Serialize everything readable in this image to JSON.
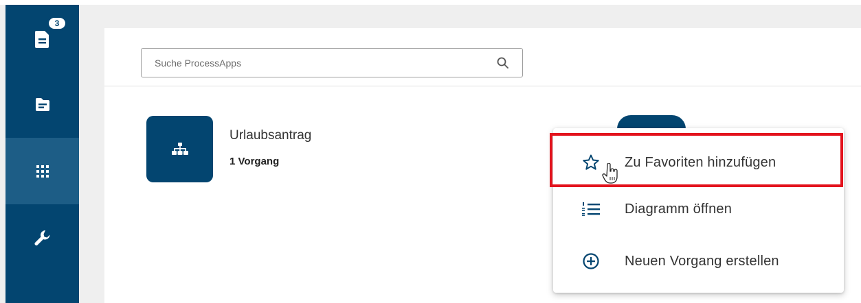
{
  "colors": {
    "primary": "#034570",
    "sidebar_active": "#1d5d86",
    "highlight": "#e3131d"
  },
  "sidebar": {
    "items": [
      {
        "name": "tasks",
        "icon": "task-document-icon",
        "badge": "3"
      },
      {
        "name": "cases",
        "icon": "folder-icon"
      },
      {
        "name": "processapps",
        "icon": "grid-icon",
        "active": true
      },
      {
        "name": "tools",
        "icon": "wrench-icon"
      }
    ]
  },
  "search": {
    "placeholder": "Suche ProcessApps"
  },
  "app": {
    "title": "Urlaubsantrag",
    "count": "1 Vorgang",
    "icon": "hierarchy-icon"
  },
  "context_menu": {
    "items": [
      {
        "label": "Zu Favoriten hinzufügen",
        "icon": "star-outline-icon"
      },
      {
        "label": "Diagramm öffnen",
        "icon": "numbered-list-icon"
      },
      {
        "label": "Neuen Vorgang erstellen",
        "icon": "add-circle-icon"
      }
    ]
  }
}
